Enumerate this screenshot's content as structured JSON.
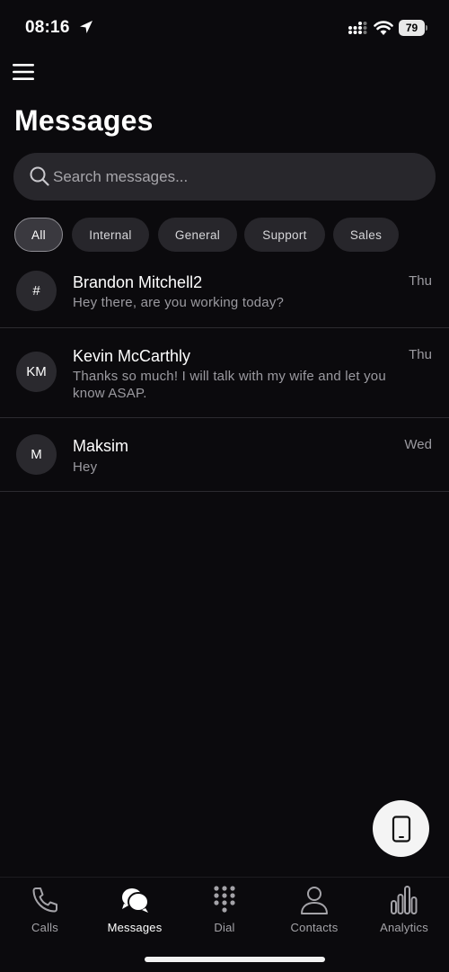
{
  "status_bar": {
    "time": "08:16",
    "battery_level": "79"
  },
  "header": {
    "title": "Messages"
  },
  "search": {
    "placeholder": "Search messages..."
  },
  "filters": [
    {
      "label": "All",
      "active": true
    },
    {
      "label": "Internal",
      "active": false
    },
    {
      "label": "General",
      "active": false
    },
    {
      "label": "Support",
      "active": false
    },
    {
      "label": "Sales",
      "active": false
    }
  ],
  "messages": [
    {
      "avatar": "#",
      "name": "Brandon Mitchell2",
      "preview": "Hey there, are you working today?",
      "time": "Thu"
    },
    {
      "avatar": "KM",
      "name": "Kevin McCarthly",
      "preview": "Thanks so much! I will talk with my wife and let you know ASAP.",
      "time": "Thu"
    },
    {
      "avatar": "M",
      "name": "Maksim",
      "preview": "Hey",
      "time": "Wed"
    }
  ],
  "tabs": [
    {
      "label": "Calls",
      "icon": "phone-icon"
    },
    {
      "label": "Messages",
      "icon": "chat-bubbles-icon",
      "active": true
    },
    {
      "label": "Dial",
      "icon": "dialpad-icon"
    },
    {
      "label": "Contacts",
      "icon": "person-icon"
    },
    {
      "label": "Analytics",
      "icon": "bar-chart-icon"
    }
  ],
  "colors": {
    "background": "#0b0a0d",
    "surface": "#28272c",
    "fab": "#f4f4f4",
    "text_secondary": "#9b9aa0"
  }
}
